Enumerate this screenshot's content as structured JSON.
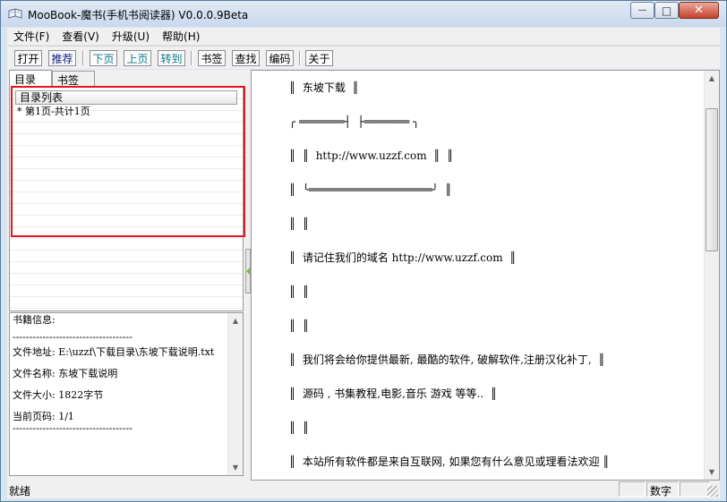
{
  "window": {
    "title": "MooBook-魔书(手机书阅读器) V0.0.0.9Beta",
    "icon": "book-app-icon",
    "caption_min": "—",
    "caption_max": "□",
    "caption_close": "✕"
  },
  "menu": [
    "文件(F)",
    "查看(V)",
    "升级(U)",
    "帮助(H)"
  ],
  "toolbar": {
    "open": "打开",
    "recommend": "推荐",
    "next_page": "下页",
    "prev_page": "上页",
    "goto": "转到",
    "bookmark": "书签",
    "find": "查找",
    "encoding": "编码",
    "about": "关于"
  },
  "left_panel": {
    "tabs": [
      "目录",
      "书签"
    ],
    "tree_header": "目录列表",
    "tree_items": [
      "* 第1页-共计1页"
    ],
    "info": {
      "heading": "书籍信息:",
      "separator": "------------------------------------",
      "file_path_label": "文件地址: E:\\uzzf\\下载目录\\东坡下载说明.txt",
      "file_name_label": "文件名称: 东坡下载说明",
      "file_size_label": "文件大小: 1822字节",
      "current_page_label": "当前页码: 1/1",
      "separator2": "------------------------------------"
    }
  },
  "reader": {
    "lines": [
      "║  东坡下载  ║",
      "╭ ═══════┤  ├═══════ ╮",
      "║  ║  http://www.uzzf.com  ║  ║",
      "║  ╰═══════════════════╯  ║",
      "║  ║",
      "║  请记住我们的域名 http://www.uzzf.com  ║",
      "║  ║",
      "║  ║",
      "║  我们将会给你提供最新, 最酷的软件, 破解软件,注册汉化补丁,  ║",
      "║  源码 , 书集教程,电影,音乐 游戏 等等..  ║",
      "║  ║",
      "║  本站所有软件都是来自互联网, 如果您有什么意见或理看法欢迎 ║"
    ]
  },
  "status": {
    "left": "就绪",
    "num": "数字"
  }
}
